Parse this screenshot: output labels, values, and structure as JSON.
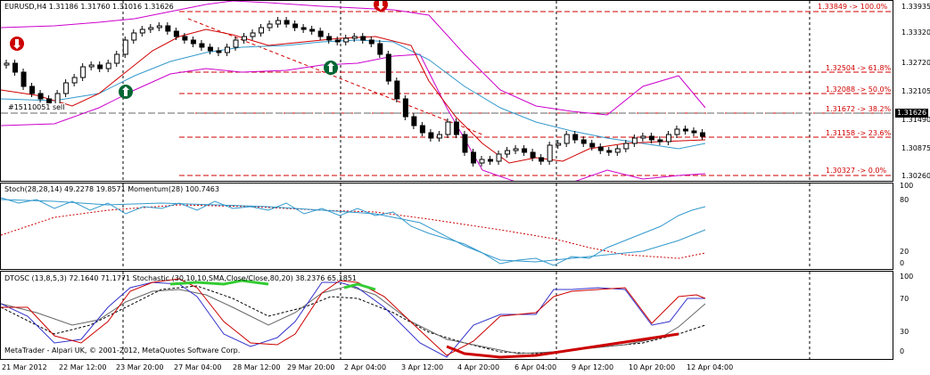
{
  "main_pane": {
    "header": "EURUSD,H4  1.31186 1.31760 1.31016 1.31626",
    "order_label": "#15110051 sell",
    "current_price": "1.31626",
    "y_ticks": [
      "1.33935",
      "1.33320",
      "1.32720",
      "1.32105",
      "1.31490",
      "1.30875",
      "1.30260"
    ],
    "fibo_levels": [
      {
        "text": "1.33849 -> 100.0%",
        "price": 1.33849
      },
      {
        "text": "1.32504 -> 61.8%",
        "price": 1.32504
      },
      {
        "text": "1.32088 -> 50.0%",
        "price": 1.32088
      },
      {
        "text": "1.31672 -> 38.2%",
        "price": 1.31672
      },
      {
        "text": "1.31158 -> 23.6%",
        "price": 1.31158
      },
      {
        "text": "1.30327 -> 0.0%",
        "price": 1.30327
      }
    ]
  },
  "stoch_pane": {
    "header": "Stoch(28,28,14) 49.2278 19.8571  Momentum(28) 100.7463",
    "y_ticks": [
      "100",
      "80",
      "20",
      "0"
    ]
  },
  "dtosc_pane": {
    "header": "DTOSC (13,8,5,3) 72.1640 71.1771  Stochastic (30,10,10,SMA,Close/Close,80,20) 38.2376 65.1851",
    "y_ticks": [
      "100",
      "70",
      "30",
      "0"
    ],
    "copyright": "MetaTrader - Alpari UK, © 2001-2012, MetaQuotes Software Corp."
  },
  "x_axis": {
    "labels": [
      "21 Mar 2012",
      "22 Mar 12:00",
      "23 Mar 20:00",
      "27 Mar 04:00",
      "28 Mar 12:00",
      "29 Mar 20:00",
      "2 Apr 04:00",
      "3 Apr 12:00",
      "4 Apr 20:00",
      "6 Apr 04:00",
      "9 Apr 12:00",
      "10 Apr 20:00",
      "12 Apr 04:00"
    ]
  },
  "colors": {
    "bollinger": "#cc00cc",
    "ma_fast": "#d00000",
    "ma_slow": "#3399cc",
    "fibo": "#d00000",
    "ball_red": "#cc0000",
    "ball_green": "#006633"
  },
  "icons": [
    "sell-arrow-icon",
    "buy-arrow-icon"
  ]
}
